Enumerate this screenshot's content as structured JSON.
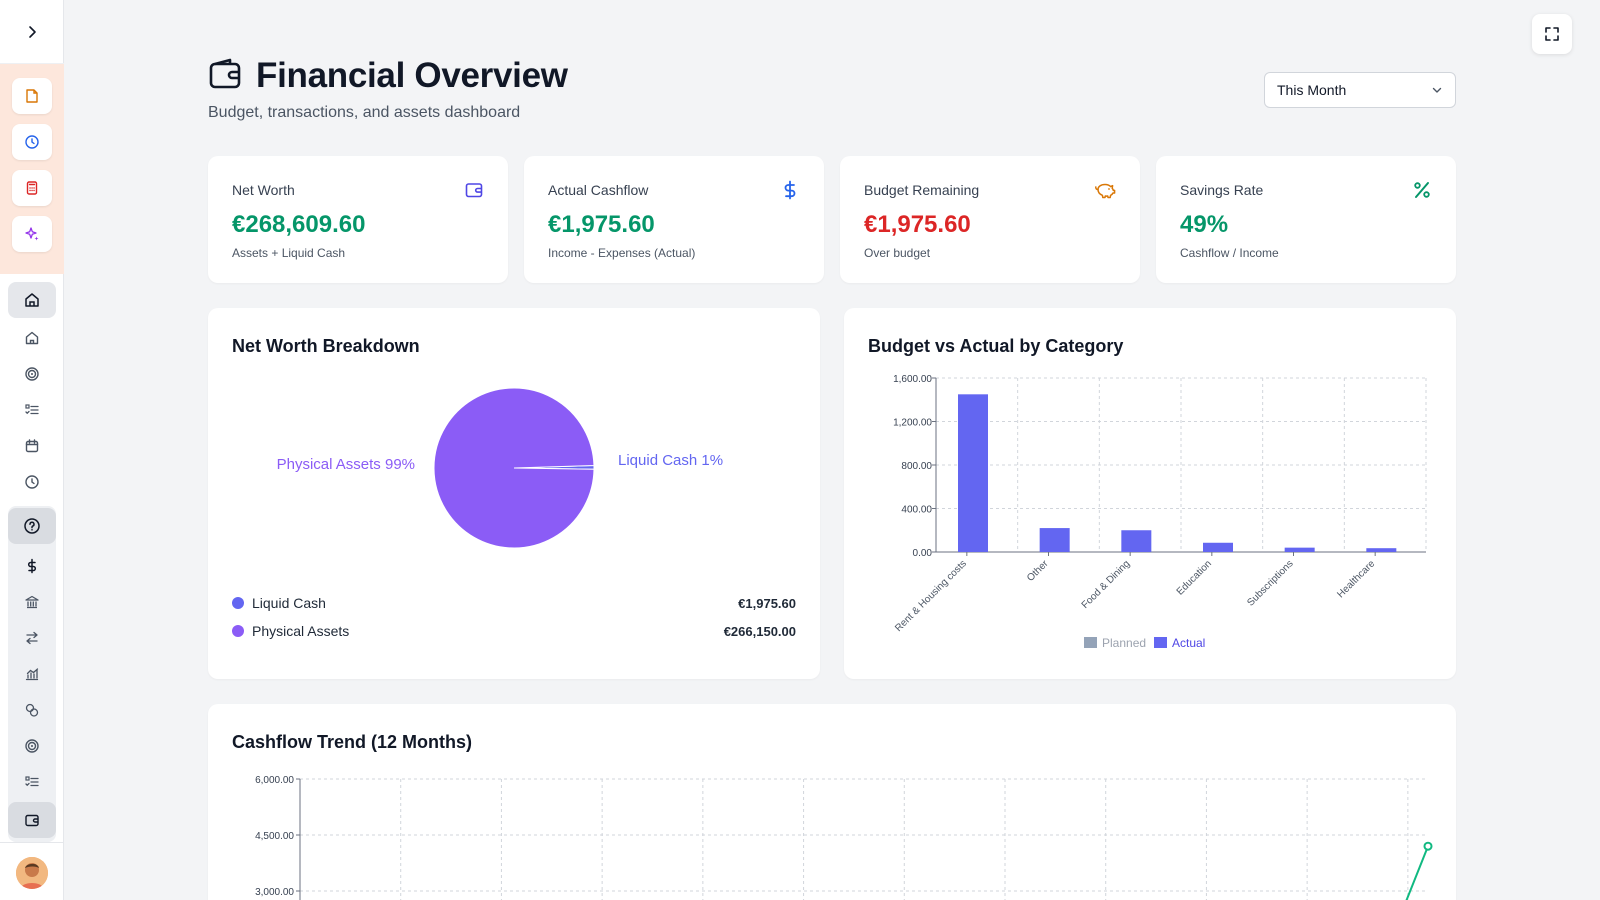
{
  "header": {
    "title": "Financial Overview",
    "subtitle": "Budget, transactions, and assets dashboard",
    "period_selected": "This Month"
  },
  "kpis": [
    {
      "label": "Net Worth",
      "value": "€268,609.60",
      "sub": "Assets + Liquid Cash",
      "icon": "wallet-icon",
      "color": "#059669",
      "icon_color": "#4f46e5"
    },
    {
      "label": "Actual Cashflow",
      "value": "€1,975.60",
      "sub": "Income - Expenses (Actual)",
      "icon": "dollar-icon",
      "color": "#059669",
      "icon_color": "#2563eb"
    },
    {
      "label": "Budget Remaining",
      "value": "€1,975.60",
      "sub": "Over budget",
      "icon": "piggy-bank-icon",
      "color": "#dc2626",
      "icon_color": "#d97706"
    },
    {
      "label": "Savings Rate",
      "value": "49%",
      "sub": "Cashflow / Income",
      "icon": "percent-icon",
      "color": "#059669",
      "icon_color": "#059669"
    }
  ],
  "net_worth": {
    "title": "Net Worth Breakdown",
    "pie_labels": [
      "Liquid Cash 1%",
      "Physical Assets 99%"
    ],
    "legend": [
      {
        "name": "Liquid Cash",
        "value": "€1,975.60",
        "color": "#6366f1"
      },
      {
        "name": "Physical Assets",
        "value": "€266,150.00",
        "color": "#8b5cf6"
      }
    ]
  },
  "budget_chart_title": "Budget vs Actual by Category",
  "cashflow_chart_title": "Cashflow Trend (12 Months)",
  "colors": {
    "accent": "#6366f1",
    "purple": "#8b5cf6",
    "planned": "#94a3b8",
    "trend": "#10b981"
  },
  "chart_data": [
    {
      "type": "pie",
      "title": "Net Worth Breakdown",
      "labels": [
        "Liquid Cash",
        "Physical Assets"
      ],
      "values": [
        1975.6,
        266150.0
      ],
      "slice_labels": [
        "Liquid Cash 1%",
        "Physical Assets 99%"
      ]
    },
    {
      "type": "bar",
      "title": "Budget vs Actual by Category",
      "categories": [
        "Rent & Housing costs",
        "Other",
        "Food & Dining",
        "Education",
        "Subscriptions",
        "Healthcare"
      ],
      "series": [
        {
          "name": "Planned",
          "values": [
            0,
            0,
            0,
            0,
            0,
            0
          ]
        },
        {
          "name": "Actual",
          "values": [
            1450,
            220,
            200,
            85,
            40,
            35
          ]
        }
      ],
      "ylim": [
        0,
        1600
      ],
      "yticks": [
        "0.00",
        "400.00",
        "800.00",
        "1,200.00",
        "1,600.00"
      ],
      "legend": "bottom"
    },
    {
      "type": "line",
      "title": "Cashflow Trend (12 Months)",
      "yticks": [
        "3,000.00",
        "4,500.00",
        "6,000.00"
      ],
      "ylim_visible": [
        3000,
        6000
      ],
      "last_point": 4200
    }
  ]
}
